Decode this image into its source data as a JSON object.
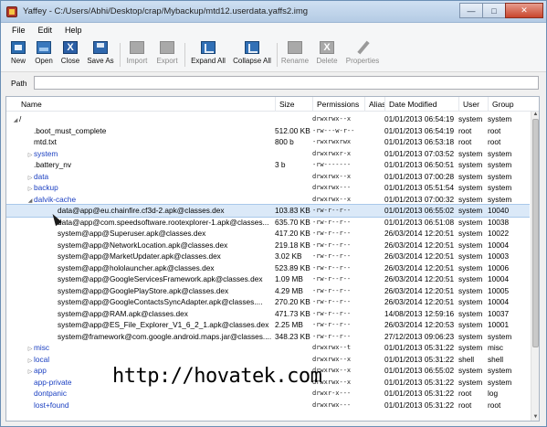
{
  "window": {
    "title": "Yaffey - C:/Users/Abhi/Desktop/crap/Mybackup/mtd12.userdata.yaffs2.img",
    "minimize_glyph": "—",
    "maximize_glyph": "□",
    "close_glyph": "✕"
  },
  "menu": [
    "File",
    "Edit",
    "Help"
  ],
  "toolbar": {
    "new": "New",
    "open": "Open",
    "close": "Close",
    "save_as": "Save As",
    "import": "Import",
    "export": "Export",
    "expand_all": "Expand All",
    "collapse_all": "Collapse All",
    "rename": "Rename",
    "delete": "Delete",
    "properties": "Properties",
    "close_glyph": "X",
    "delete_glyph": "X"
  },
  "path": {
    "label": "Path",
    "value": ""
  },
  "columns": [
    "Name",
    "Size",
    "Permissions",
    "Alias",
    "Date Modified",
    "User",
    "Group"
  ],
  "tree_glyphs": {
    "expanded": "◢",
    "collapsed": "▷"
  },
  "rows": [
    {
      "name": "/",
      "size": "",
      "perm": "drwxrwx--x",
      "alias": "",
      "date": "01/01/2013 06:54:19",
      "user": "system",
      "group": "system",
      "twisty": "expanded",
      "folder": false
    },
    {
      "name": ".boot_must_complete",
      "size": "512.00 KB",
      "perm": "-rw---w-r--",
      "alias": "",
      "date": "01/01/2013 06:54:19",
      "user": "root",
      "group": "root",
      "twisty": "",
      "folder": false
    },
    {
      "name": "mtd.txt",
      "size": "800 b",
      "perm": "-rwxrwxrwx",
      "alias": "",
      "date": "01/01/2013 06:53:18",
      "user": "root",
      "group": "root",
      "twisty": "",
      "folder": false
    },
    {
      "name": "system",
      "size": "",
      "perm": "drwxrwxr-x",
      "alias": "",
      "date": "01/01/2013 07:03:52",
      "user": "system",
      "group": "system",
      "twisty": "collapsed",
      "folder": true
    },
    {
      "name": ".battery_nv",
      "size": "3 b",
      "perm": "-rw-------",
      "alias": "",
      "date": "01/01/2013 06:50:51",
      "user": "system",
      "group": "system",
      "twisty": "",
      "folder": false
    },
    {
      "name": "data",
      "size": "",
      "perm": "drwxrwx--x",
      "alias": "",
      "date": "01/01/2013 07:00:28",
      "user": "system",
      "group": "system",
      "twisty": "collapsed",
      "folder": true
    },
    {
      "name": "backup",
      "size": "",
      "perm": "drwxrwx---",
      "alias": "",
      "date": "01/01/2013 05:51:54",
      "user": "system",
      "group": "system",
      "twisty": "collapsed",
      "folder": true
    },
    {
      "name": "dalvik-cache",
      "size": "",
      "perm": "drwxrwx--x",
      "alias": "",
      "date": "01/01/2013 07:00:32",
      "user": "system",
      "group": "system",
      "twisty": "expanded",
      "folder": true
    },
    {
      "name": "data@app@eu.chainfire.cf3d-2.apk@classes.dex",
      "size": "103.83 KB",
      "perm": "-rw-r--r--",
      "alias": "",
      "date": "01/01/2013 06:55:02",
      "user": "system",
      "group": "10040",
      "twisty": "",
      "folder": false,
      "selected": true
    },
    {
      "name": "data@app@com.speedsoftware.rootexplorer-1.apk@classes...",
      "size": "635.70 KB",
      "perm": "-rw-r--r--",
      "alias": "",
      "date": "01/01/2013 06:51:08",
      "user": "system",
      "group": "10038",
      "twisty": "",
      "folder": false
    },
    {
      "name": "system@app@Superuser.apk@classes.dex",
      "size": "417.20 KB",
      "perm": "-rw-r--r--",
      "alias": "",
      "date": "26/03/2014 12:20:51",
      "user": "system",
      "group": "10022",
      "twisty": "",
      "folder": false
    },
    {
      "name": "system@app@NetworkLocation.apk@classes.dex",
      "size": "219.18 KB",
      "perm": "-rw-r--r--",
      "alias": "",
      "date": "26/03/2014 12:20:51",
      "user": "system",
      "group": "10004",
      "twisty": "",
      "folder": false
    },
    {
      "name": "system@app@MarketUpdater.apk@classes.dex",
      "size": "3.02 KB",
      "perm": "-rw-r--r--",
      "alias": "",
      "date": "26/03/2014 12:20:51",
      "user": "system",
      "group": "10003",
      "twisty": "",
      "folder": false
    },
    {
      "name": "system@app@hololauncher.apk@classes.dex",
      "size": "523.89 KB",
      "perm": "-rw-r--r--",
      "alias": "",
      "date": "26/03/2014 12:20:51",
      "user": "system",
      "group": "10006",
      "twisty": "",
      "folder": false
    },
    {
      "name": "system@app@GoogleServicesFramework.apk@classes.dex",
      "size": "1.09 MB",
      "perm": "-rw-r--r--",
      "alias": "",
      "date": "26/03/2014 12:20:51",
      "user": "system",
      "group": "10004",
      "twisty": "",
      "folder": false
    },
    {
      "name": "system@app@GooglePlayStore.apk@classes.dex",
      "size": "4.29 MB",
      "perm": "-rw-r--r--",
      "alias": "",
      "date": "26/03/2014 12:20:51",
      "user": "system",
      "group": "10005",
      "twisty": "",
      "folder": false
    },
    {
      "name": "system@app@GoogleContactsSyncAdapter.apk@classes....",
      "size": "270.20 KB",
      "perm": "-rw-r--r--",
      "alias": "",
      "date": "26/03/2014 12:20:51",
      "user": "system",
      "group": "10004",
      "twisty": "",
      "folder": false
    },
    {
      "name": "system@app@RAM.apk@classes.dex",
      "size": "471.73 KB",
      "perm": "-rw-r--r--",
      "alias": "",
      "date": "14/08/2013 12:59:16",
      "user": "system",
      "group": "10037",
      "twisty": "",
      "folder": false
    },
    {
      "name": "system@app@ES_File_Explorer_V1_6_2_1.apk@classes.dex",
      "size": "2.25 MB",
      "perm": "-rw-r--r--",
      "alias": "",
      "date": "26/03/2014 12:20:53",
      "user": "system",
      "group": "10001",
      "twisty": "",
      "folder": false
    },
    {
      "name": "system@framework@com.google.android.maps.jar@classes....",
      "size": "348.23 KB",
      "perm": "-rw-r--r--",
      "alias": "",
      "date": "27/12/2013 09:06:23",
      "user": "system",
      "group": "system",
      "twisty": "",
      "folder": false
    },
    {
      "name": "misc",
      "size": "",
      "perm": "drwxrwx--t",
      "alias": "",
      "date": "01/01/2013 05:31:22",
      "user": "system",
      "group": "misc",
      "twisty": "collapsed",
      "folder": true
    },
    {
      "name": "local",
      "size": "",
      "perm": "drwxrwx--x",
      "alias": "",
      "date": "01/01/2013 05:31:22",
      "user": "shell",
      "group": "shell",
      "twisty": "collapsed",
      "folder": true
    },
    {
      "name": "app",
      "size": "",
      "perm": "drwxrwx--x",
      "alias": "",
      "date": "01/01/2013 06:55:02",
      "user": "system",
      "group": "system",
      "twisty": "collapsed",
      "folder": true
    },
    {
      "name": "app-private",
      "size": "",
      "perm": "drwxrwx--x",
      "alias": "",
      "date": "01/01/2013 05:31:22",
      "user": "system",
      "group": "system",
      "twisty": "",
      "folder": true
    },
    {
      "name": "dontpanic",
      "size": "",
      "perm": "drwxr-x---",
      "alias": "",
      "date": "01/01/2013 05:31:22",
      "user": "root",
      "group": "log",
      "twisty": "",
      "folder": true
    },
    {
      "name": "lost+found",
      "size": "",
      "perm": "drwxrwx---",
      "alias": "",
      "date": "01/01/2013 05:31:22",
      "user": "root",
      "group": "root",
      "twisty": "",
      "folder": true
    }
  ],
  "scroll_glyphs": {
    "up": "▲",
    "down": "▼"
  },
  "watermark": "http://hovatek.com"
}
